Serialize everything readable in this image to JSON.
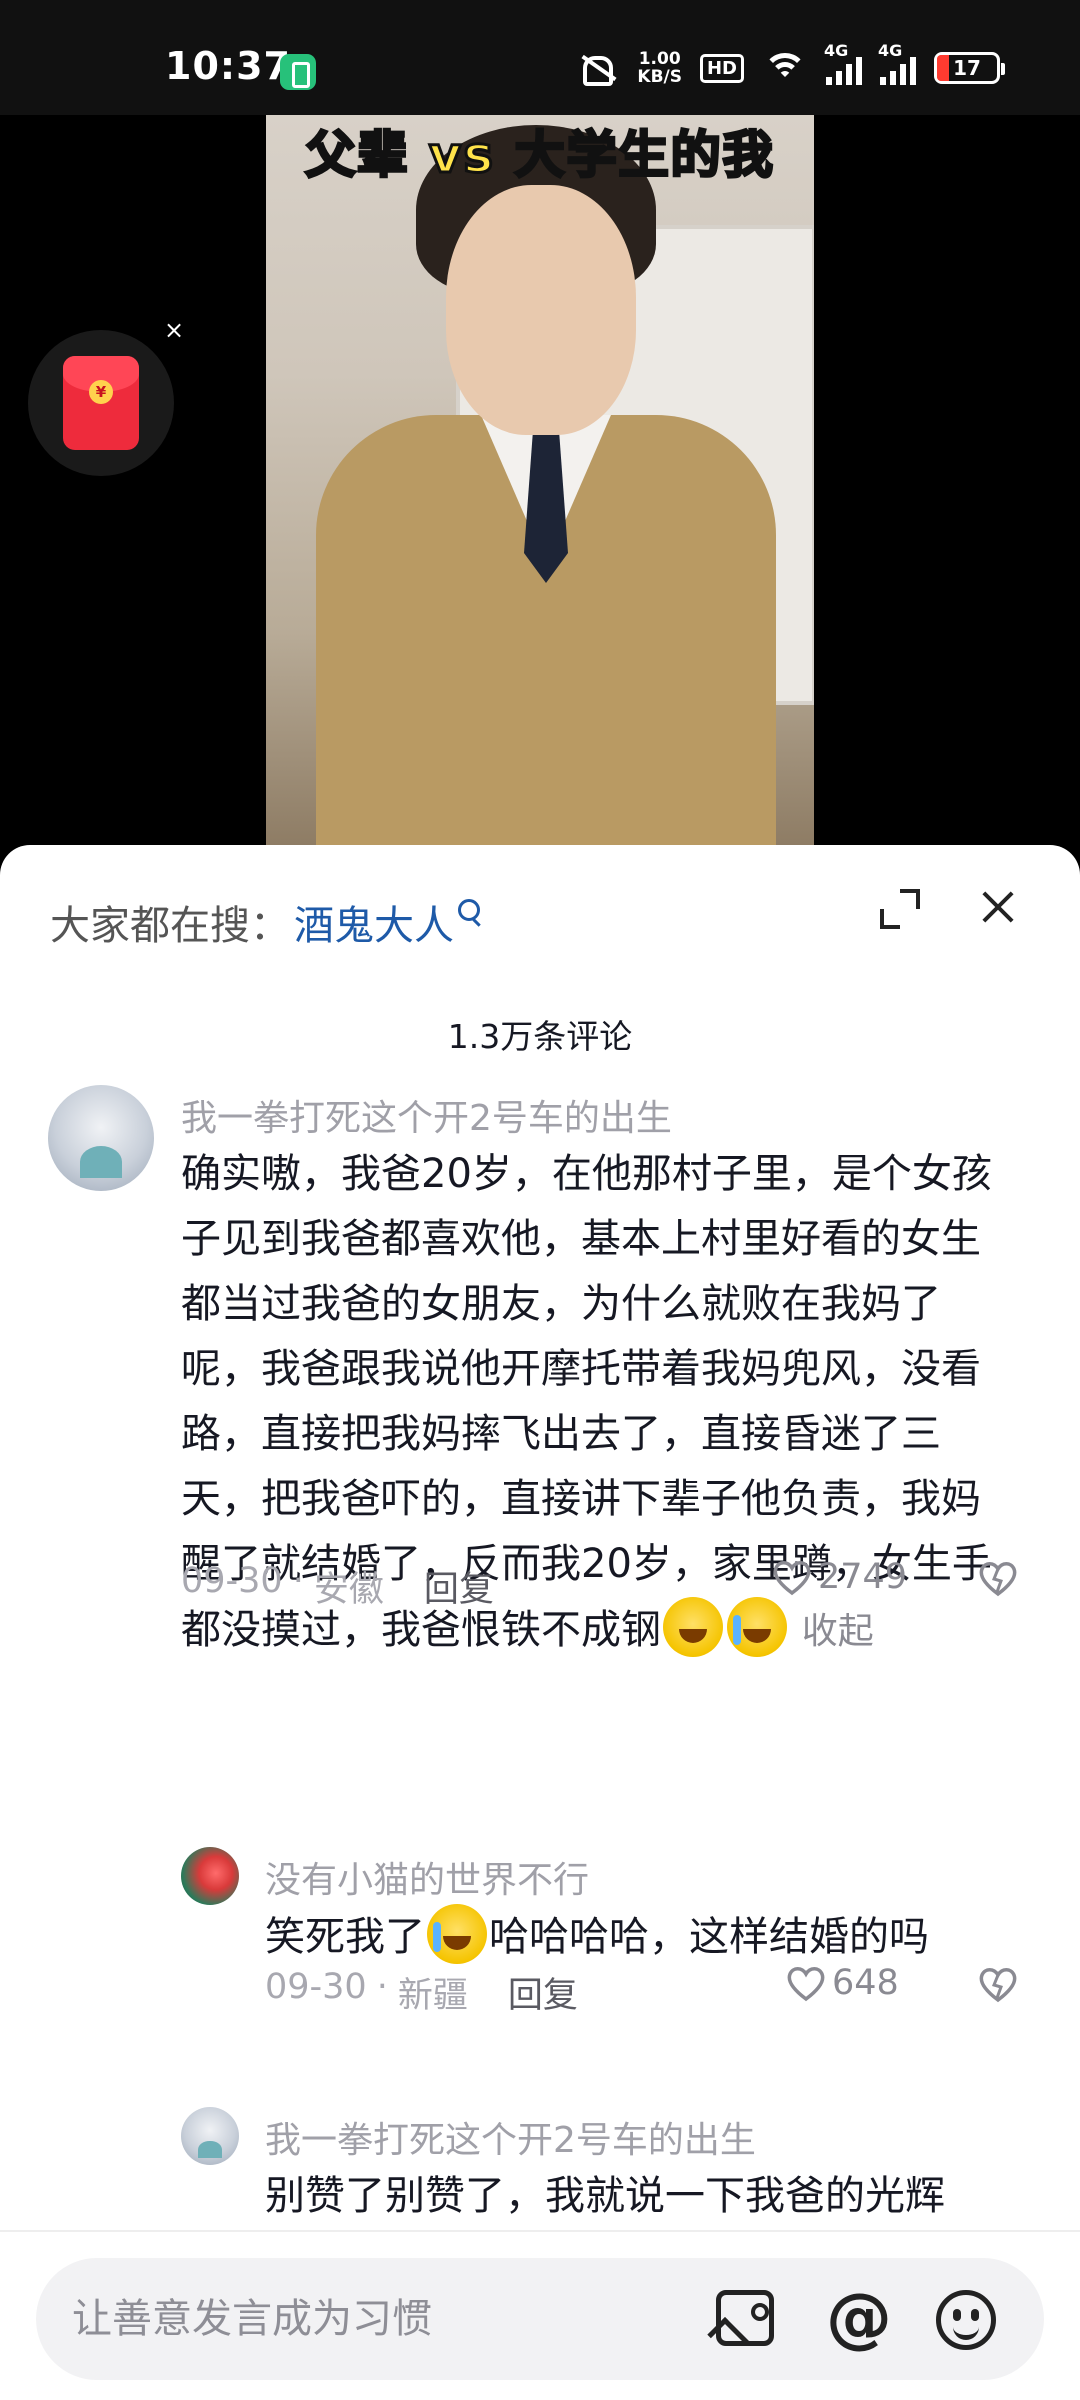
{
  "status_bar": {
    "time": "10:37",
    "net_speed_value": "1.00",
    "net_speed_unit": "KB/S",
    "hd_label": "HD",
    "signal_label_1": "4G",
    "signal_label_2": "4G",
    "battery_level": "17",
    "battery_color": "#ff3b30"
  },
  "video": {
    "title_overlay": "父辈 vs 大学生的我"
  },
  "floating": {
    "close_label": "×",
    "coin_symbol": "¥"
  },
  "sheet": {
    "search_prefix": "大家都在搜：",
    "search_term": "酒鬼大人",
    "comment_count": "1.3万条评论",
    "accent_color": "#1e5aa8"
  },
  "comments": [
    {
      "username": "我一拳打死这个开2号车的出生",
      "content": "确实嗷，我爸20岁，在他那村子里，是个女孩子见到我爸都喜欢他，基本上村里好看的女生都当过我爸的女朋友，为什么就败在我妈了呢，我爸跟我说他开摩托带着我妈兜风，没看路，直接把我妈摔飞出去了，直接昏迷了三天，把我爸吓的，直接讲下辈子他负责，我妈醒了就结婚了，反而我20岁，家里蹲，女生手都没摸过，我爸恨铁不成钢",
      "collapse": "收起",
      "date": "09-30",
      "sep": "·",
      "location": "安徽",
      "reply": "回复",
      "likes": "2749"
    },
    {
      "username": "没有小猫的世界不行",
      "content_before": "笑死我了",
      "content_after": "哈哈哈哈，这样结婚的吗",
      "date": "09-30",
      "sep": "·",
      "location": "新疆",
      "reply": "回复",
      "likes": "648"
    },
    {
      "username": "我一拳打死这个开2号车的出生",
      "content": "别赞了别赞了，我就说一下我爸的光辉"
    }
  ],
  "input": {
    "placeholder": "让善意发言成为习惯",
    "at_symbol": "@"
  },
  "icons": [
    "mute-icon",
    "wifi-icon",
    "battery-icon",
    "red-packet-icon",
    "search-icon",
    "expand-icon",
    "close-icon",
    "heart-icon",
    "dislike-icon",
    "image-icon",
    "at-icon",
    "emoji-icon"
  ]
}
